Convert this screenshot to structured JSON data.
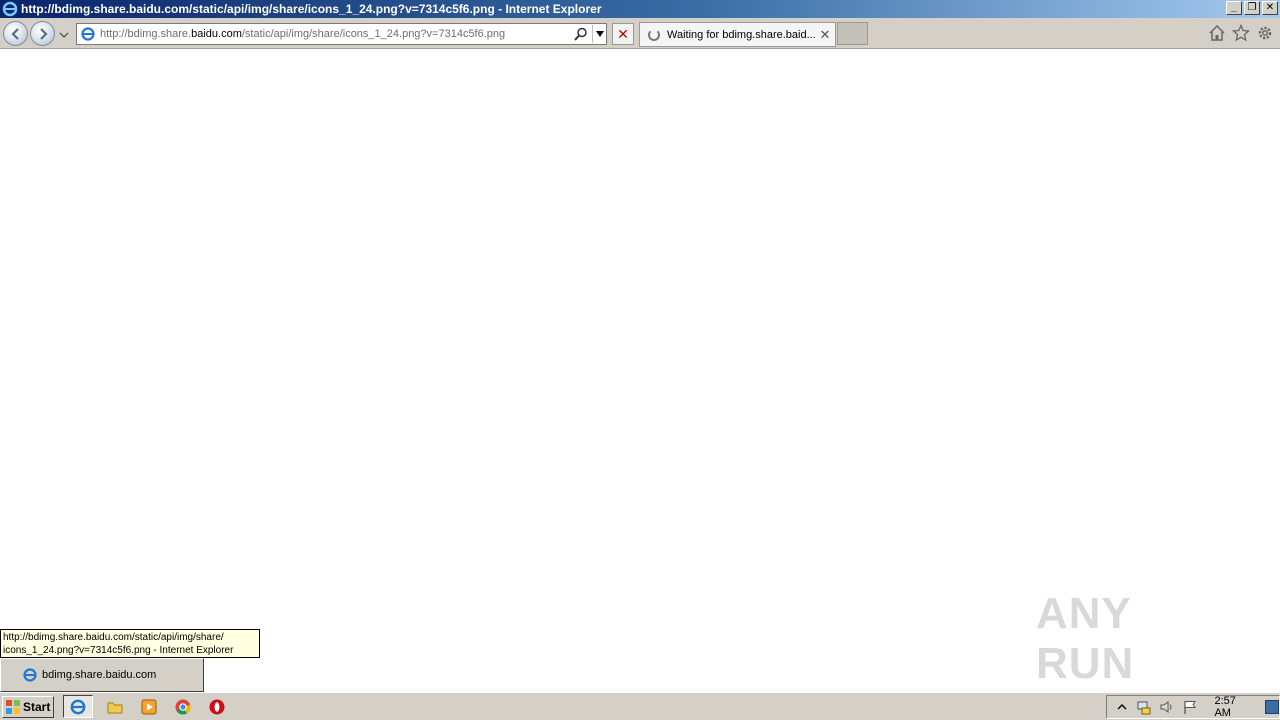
{
  "window": {
    "title": "http://bdimg.share.baidu.com/static/api/img/share/icons_1_24.png?v=7314c5f6.png - Internet Explorer",
    "controls": {
      "minimize": "_",
      "restore": "❐",
      "close": "✕"
    }
  },
  "address_bar": {
    "url_prefix": "http://bdimg.share.",
    "url_domain": "baidu.com",
    "url_suffix": "/static/api/img/share/icons_1_24.png?v=7314c5f6.png"
  },
  "tab": {
    "title": "Waiting for bdimg.share.baid...",
    "close": "✕"
  },
  "stop_button": "✕",
  "tooltip": {
    "line1": "http://bdimg.share.baidu.com/static/api/img/share/",
    "line2": "icons_1_24.png?v=7314c5f6.png - Internet Explorer"
  },
  "taskbar_thumbnail": {
    "label": "bdimg.share.baidu.com"
  },
  "watermark": "ANY RUN",
  "taskbar": {
    "start_label": "Start",
    "clock": "2:57 AM",
    "quick_launch": [
      "internet-explorer-icon",
      "file-explorer-icon",
      "media-player-icon",
      "chrome-icon",
      "opera-icon"
    ]
  },
  "colors": {
    "title_gradient_start": "#0a246a",
    "title_gradient_end": "#a6caf0",
    "chrome_gray": "#d4d0c8",
    "tooltip_bg": "#ffffe1"
  }
}
